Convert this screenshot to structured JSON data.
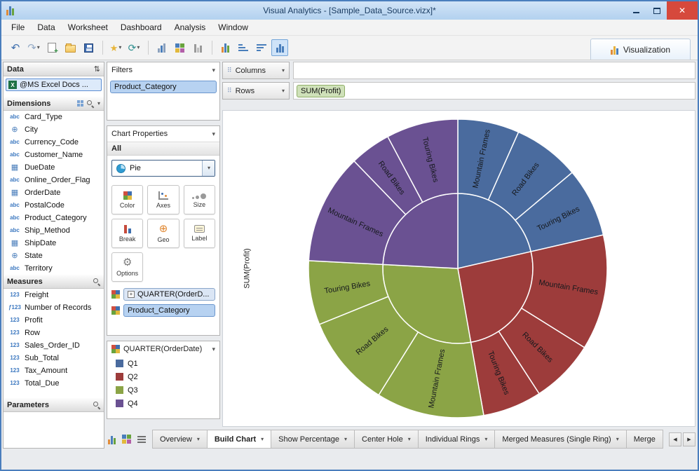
{
  "window": {
    "title": "Visual Analytics - [Sample_Data_Source.vizx]*"
  },
  "menu": {
    "items": [
      {
        "label": "File"
      },
      {
        "label": "Data"
      },
      {
        "label": "Worksheet"
      },
      {
        "label": "Dashboard"
      },
      {
        "label": "Analysis"
      },
      {
        "label": "Window"
      }
    ]
  },
  "toolbar": {
    "visualization_tab": "Visualization"
  },
  "data_panel": {
    "header": "Data",
    "source": "@MS Excel Docs ...",
    "dimensions": {
      "header": "Dimensions",
      "items": [
        {
          "type": "abc",
          "label": "Card_Type"
        },
        {
          "type": "geo",
          "label": "City"
        },
        {
          "type": "abc",
          "label": "Currency_Code"
        },
        {
          "type": "abc",
          "label": "Customer_Name"
        },
        {
          "type": "date",
          "label": "DueDate"
        },
        {
          "type": "abc",
          "label": "Online_Order_Flag"
        },
        {
          "type": "date",
          "label": "OrderDate"
        },
        {
          "type": "abc",
          "label": "PostalCode"
        },
        {
          "type": "abc",
          "label": "Product_Category"
        },
        {
          "type": "abc",
          "label": "Ship_Method"
        },
        {
          "type": "date",
          "label": "ShipDate"
        },
        {
          "type": "geo",
          "label": "State"
        },
        {
          "type": "abc",
          "label": "Territory"
        }
      ]
    },
    "measures": {
      "header": "Measures",
      "items": [
        {
          "type": "num",
          "label": "Freight"
        },
        {
          "type": "fnum",
          "label": "Number of Records"
        },
        {
          "type": "num",
          "label": "Profit"
        },
        {
          "type": "num",
          "label": "Row"
        },
        {
          "type": "num",
          "label": "Sales_Order_ID"
        },
        {
          "type": "num",
          "label": "Sub_Total"
        },
        {
          "type": "num",
          "label": "Tax_Amount"
        },
        {
          "type": "num",
          "label": "Total_Due"
        }
      ]
    },
    "parameters": {
      "header": "Parameters"
    }
  },
  "filters_panel": {
    "header": "Filters",
    "items": [
      {
        "label": "Product_Category"
      }
    ]
  },
  "chart_properties": {
    "header": "Chart Properties",
    "scope": "All",
    "chart_type": "Pie",
    "tool_buttons": [
      {
        "label": "Color"
      },
      {
        "label": "Axes"
      },
      {
        "label": "Size"
      },
      {
        "label": "Break"
      },
      {
        "label": "Geo"
      },
      {
        "label": "Label"
      },
      {
        "label": "Options"
      }
    ],
    "bindings": [
      {
        "label": "QUARTER(OrderD...",
        "expandable": true
      },
      {
        "label": "Product_Category",
        "expandable": false
      }
    ]
  },
  "legend": {
    "header": "QUARTER(OrderDate)",
    "items": [
      {
        "label": "Q1",
        "color": "#4a6b9e"
      },
      {
        "label": "Q2",
        "color": "#9d3c3b"
      },
      {
        "label": "Q3",
        "color": "#8ba446"
      },
      {
        "label": "Q4",
        "color": "#6a5192"
      }
    ]
  },
  "shelves": {
    "columns_label": "Columns",
    "rows_label": "Rows",
    "rows_pills": [
      {
        "label": "SUM(Profit)"
      }
    ]
  },
  "chart_data": {
    "type": "sunburst",
    "measure_axis_label": "SUM(Profit)",
    "inner_dimension": "QUARTER(OrderDate)",
    "outer_dimension": "Product_Category",
    "angle_unit": "degrees_clockwise_from_top",
    "quarters": [
      {
        "name": "Q1",
        "color": "#4a6b9e",
        "start": 0,
        "end": 77,
        "segments": [
          {
            "label": "Mountain Frames",
            "start": 0,
            "end": 24
          },
          {
            "label": "Road Bikes",
            "start": 24,
            "end": 50
          },
          {
            "label": "Touring Bikes",
            "start": 50,
            "end": 77
          }
        ]
      },
      {
        "name": "Q2",
        "color": "#9d3c3b",
        "start": 77,
        "end": 170,
        "segments": [
          {
            "label": "Mountain Frames",
            "start": 77,
            "end": 122
          },
          {
            "label": "Road Bikes",
            "start": 122,
            "end": 147
          },
          {
            "label": "Touring Bikes",
            "start": 147,
            "end": 170
          }
        ]
      },
      {
        "name": "Q3",
        "color": "#8ba446",
        "start": 170,
        "end": 273,
        "segments": [
          {
            "label": "Mountain Frames",
            "start": 170,
            "end": 212
          },
          {
            "label": "Road Bikes",
            "start": 212,
            "end": 248
          },
          {
            "label": "Touring Bikes",
            "start": 248,
            "end": 273
          }
        ]
      },
      {
        "name": "Q4",
        "color": "#6a5192",
        "start": 273,
        "end": 360,
        "segments": [
          {
            "label": "Mountain Frames",
            "start": 273,
            "end": 316
          },
          {
            "label": "Road Bikes",
            "start": 316,
            "end": 332
          },
          {
            "label": "Touring Bikes",
            "start": 332,
            "end": 360
          }
        ]
      }
    ]
  },
  "bottom_bar": {
    "tabs": [
      {
        "label": "Overview",
        "active": false
      },
      {
        "label": "Build Chart",
        "active": true
      },
      {
        "label": "Show Percentage",
        "active": false
      },
      {
        "label": "Center Hole",
        "active": false
      },
      {
        "label": "Individual Rings",
        "active": false
      },
      {
        "label": "Merged Measures (Single Ring)",
        "active": false
      },
      {
        "label": "Merge",
        "active": false
      }
    ]
  },
  "icons": {
    "dropdown": "▾",
    "swap": "⇅",
    "undo": "↶",
    "redo": "↷",
    "refresh": "⟳",
    "wizard": "★",
    "close": "✕",
    "nav_left": "◀",
    "nav_right": "▶",
    "plus": "+",
    "gear": "⚙",
    "globe": "⊕",
    "calendar": "▦",
    "abc": "abc",
    "num": "123",
    "fnum": "ƒ123",
    "grip": "⠿"
  }
}
